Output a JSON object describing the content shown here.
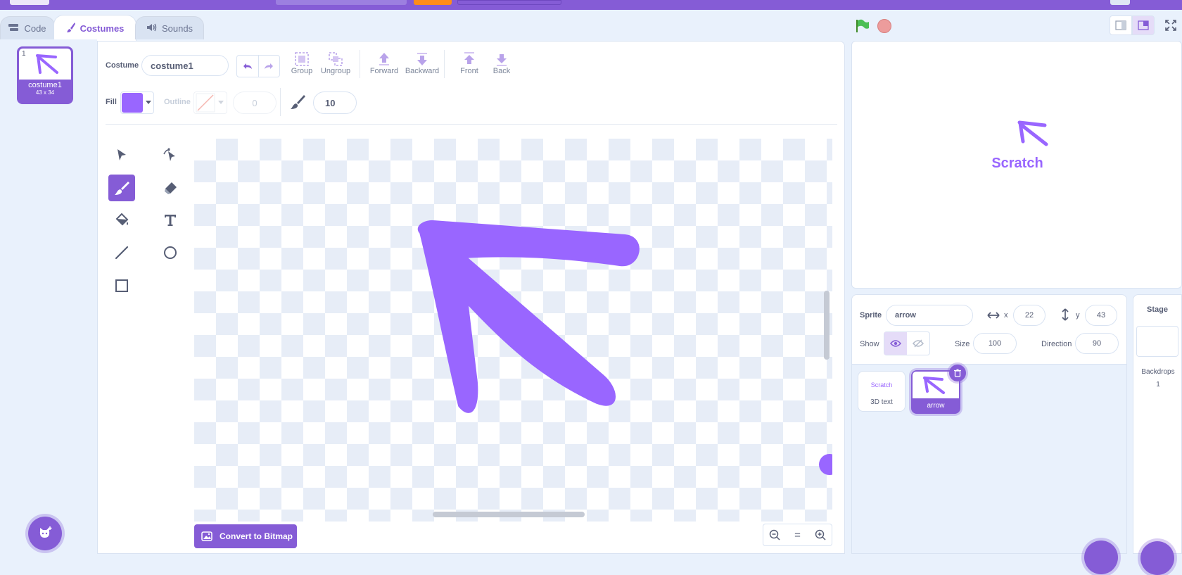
{
  "tabs": {
    "code": "Code",
    "costumes": "Costumes",
    "sounds": "Sounds"
  },
  "costume_list": {
    "items": [
      {
        "number": "1",
        "name": "costume1",
        "size": "43 x 34"
      }
    ]
  },
  "toolbar": {
    "costume_label": "Costume",
    "costume_name": "costume1",
    "group": "Group",
    "ungroup": "Ungroup",
    "forward": "Forward",
    "backward": "Backward",
    "front": "Front",
    "back": "Back",
    "fill_label": "Fill",
    "outline_label": "Outline",
    "outline_width": "0",
    "brush_size": "10"
  },
  "colors": {
    "accent": "#855cd6",
    "fill": "#9966ff",
    "canvas_tint": "#e7edf7"
  },
  "canvas": {
    "convert_button": "Convert to Bitmap",
    "zoom_reset": "="
  },
  "stage": {
    "label_text": "Scratch"
  },
  "sprite_info": {
    "sprite_label": "Sprite",
    "sprite_name": "arrow",
    "x_label": "x",
    "x_value": "22",
    "y_label": "y",
    "y_value": "43",
    "show_label": "Show",
    "size_label": "Size",
    "size_value": "100",
    "direction_label": "Direction",
    "direction_value": "90"
  },
  "sprites": [
    {
      "thumb_text": "Scratch",
      "name": "3D text"
    },
    {
      "name": "arrow"
    }
  ],
  "stage_pane": {
    "title": "Stage",
    "backdrops_label": "Backdrops",
    "backdrops_count": "1"
  }
}
